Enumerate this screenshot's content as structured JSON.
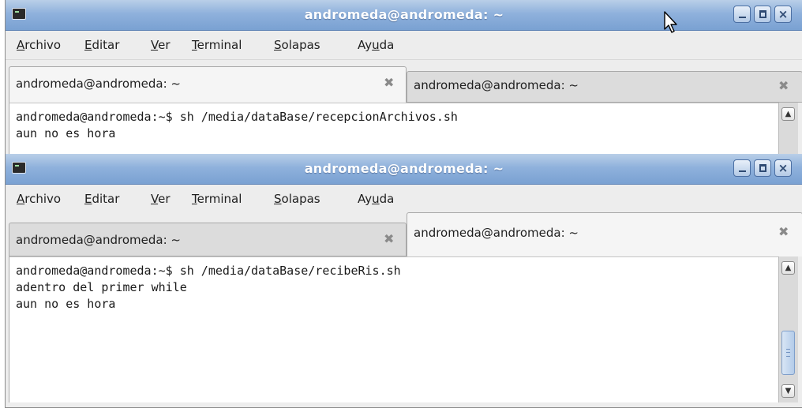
{
  "window_back": {
    "title": "andromeda@andromeda: ~",
    "menu": {
      "archivo_mn": "A",
      "archivo_rest": "rchivo",
      "editar_mn": "E",
      "editar_rest": "ditar",
      "ver_mn": "V",
      "ver_rest": "er",
      "terminal_mn": "T",
      "terminal_rest": "erminal",
      "solapas_mn": "S",
      "solapas_rest": "olapas",
      "ayuda_pre": "Ay",
      "ayuda_mn": "u",
      "ayuda_post": "da"
    },
    "tabs": [
      {
        "label": "andromeda@andromeda: ~",
        "close": "✖"
      },
      {
        "label": "andromeda@andromeda: ~",
        "close": "✖"
      }
    ],
    "terminal_lines": [
      "andromeda@andromeda:~$ sh /media/dataBase/recepcionArchivos.sh",
      "aun no es hora"
    ]
  },
  "window_front": {
    "title": "andromeda@andromeda: ~",
    "menu": {
      "archivo_mn": "A",
      "archivo_rest": "rchivo",
      "editar_mn": "E",
      "editar_rest": "ditar",
      "ver_mn": "V",
      "ver_rest": "er",
      "terminal_mn": "T",
      "terminal_rest": "erminal",
      "solapas_mn": "S",
      "solapas_rest": "olapas",
      "ayuda_pre": "Ay",
      "ayuda_mn": "u",
      "ayuda_post": "da"
    },
    "tabs": [
      {
        "label": "andromeda@andromeda: ~",
        "close": "✖"
      },
      {
        "label": "andromeda@andromeda: ~",
        "close": "✖"
      }
    ],
    "terminal_lines": [
      "andromeda@andromeda:~$ sh /media/dataBase/recibeRis.sh",
      "adentro del primer while",
      "aun no es hora"
    ],
    "scroll_position": 0.88
  },
  "icons": {
    "app": "terminal-icon",
    "minimize": "minimize-icon",
    "maximize": "maximize-icon",
    "close": "close-icon",
    "cursor": "mouse-pointer-icon",
    "tab_close": "tab-close-icon",
    "scroll_up": "arrow-up-icon",
    "scroll_down": "arrow-down-icon"
  },
  "colors": {
    "titlebar": "#8fb1dc",
    "title_text": "#ffffff",
    "window_bg": "#ededed",
    "terminal_bg": "#ffffff",
    "terminal_text": "#1a1a1a"
  }
}
